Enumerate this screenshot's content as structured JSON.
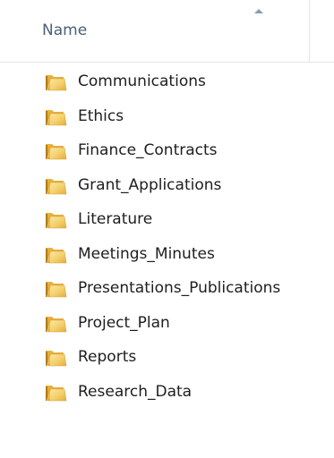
{
  "header": {
    "name_column_label": "Name",
    "sort_icon": "sort-ascending-icon"
  },
  "folder_icon": "folder-icon",
  "folders": [
    {
      "name": "Communications"
    },
    {
      "name": "Ethics"
    },
    {
      "name": "Finance_Contracts"
    },
    {
      "name": "Grant_Applications"
    },
    {
      "name": "Literature"
    },
    {
      "name": "Meetings_Minutes"
    },
    {
      "name": "Presentations_Publications"
    },
    {
      "name": "Project_Plan"
    },
    {
      "name": "Reports"
    },
    {
      "name": "Research_Data"
    }
  ]
}
